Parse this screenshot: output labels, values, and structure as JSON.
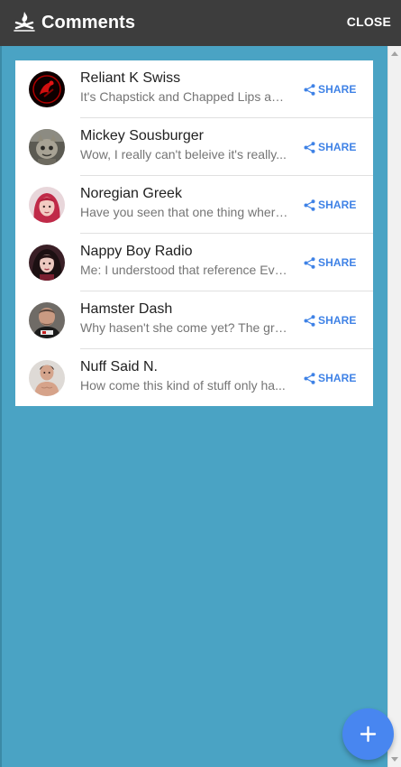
{
  "header": {
    "title": "Comments",
    "close_label": "CLOSE",
    "logo_icon": "campfire-icon"
  },
  "comments": [
    {
      "name": "Reliant K Swiss",
      "preview": "It's Chapstick and Chapped Lips and...",
      "share_label": "SHARE",
      "avatar_icon": "red-logo-avatar"
    },
    {
      "name": "Mickey Sousburger",
      "preview": "Wow, I really can't beleive it's really...",
      "share_label": "SHARE",
      "avatar_icon": "character-avatar"
    },
    {
      "name": "Noregian Greek",
      "preview": "Have you seen that one thing where...",
      "share_label": "SHARE",
      "avatar_icon": "red-hair-avatar"
    },
    {
      "name": "Nappy Boy Radio",
      "preview": "Me: I understood that reference Eve...",
      "share_label": "SHARE",
      "avatar_icon": "dark-hair-avatar"
    },
    {
      "name": "Hamster Dash",
      "preview": "Why hasen't she come yet? The gra...",
      "share_label": "SHARE",
      "avatar_icon": "man-avatar"
    },
    {
      "name": "Nuff Said N.",
      "preview": "How come this kind of stuff only ha...",
      "share_label": "SHARE",
      "avatar_icon": "shirtless-avatar"
    }
  ],
  "fab": {
    "icon": "plus-icon"
  },
  "colors": {
    "header_bg": "#3d3d3d",
    "page_bg": "#4aa3c4",
    "accent": "#3f82e6",
    "fab_bg": "#4886f0"
  }
}
